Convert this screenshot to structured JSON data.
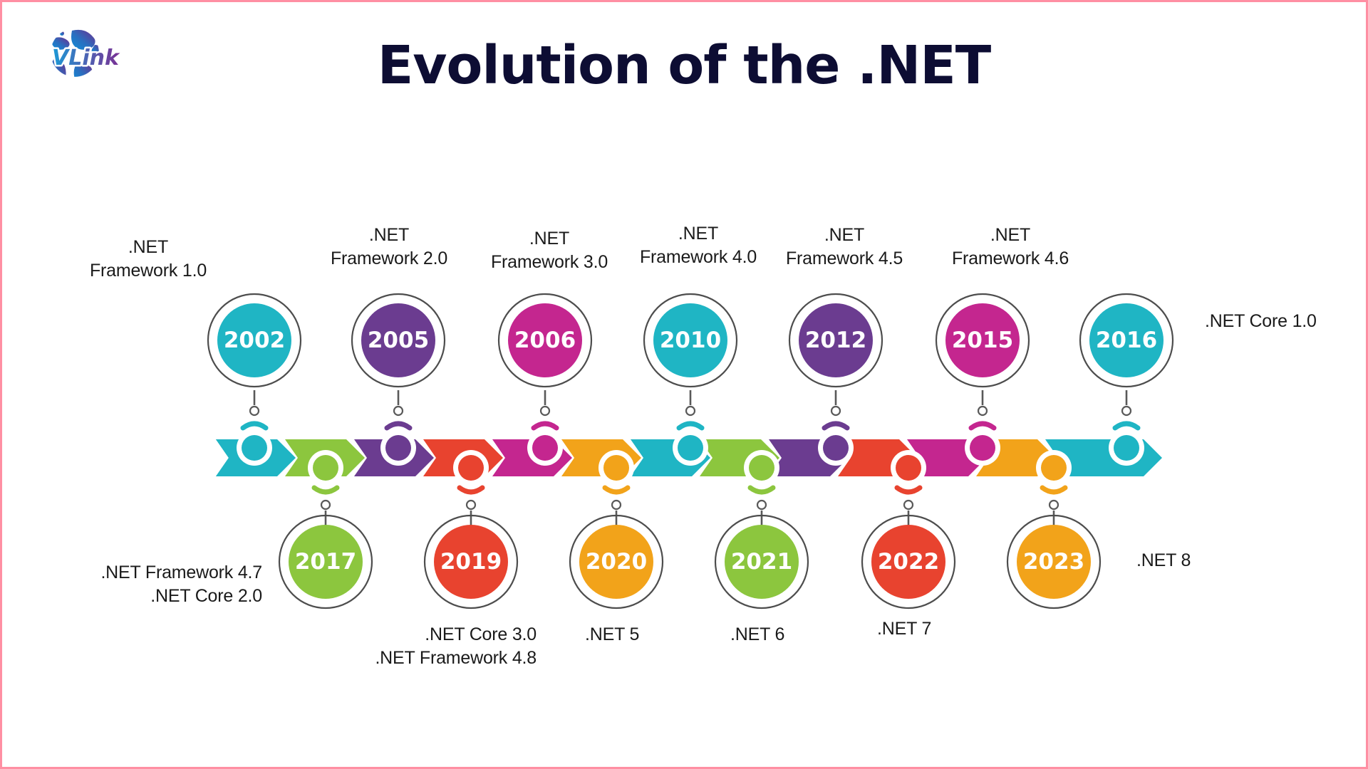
{
  "page": {
    "title": "Evolution of the .NET",
    "border_color": "#ff8fa3",
    "background": "#ffffff",
    "title_color": "#0d0d33"
  },
  "logo": {
    "name": "VLink",
    "text": "VLink",
    "gradient_start": "#1c9ad6",
    "gradient_end": "#6d2e8e"
  },
  "palette": {
    "teal": "#1fb5c4",
    "purple": "#6b3c90",
    "magenta": "#c4268f",
    "green": "#8cc63e",
    "red": "#e8432f",
    "orange": "#f2a31a",
    "ring": "#4d4d4d",
    "connector": "#595959",
    "white": "#ffffff"
  },
  "chart_data": {
    "type": "timeline",
    "title": "Evolution of the .NET",
    "orientation": "horizontal",
    "segment_count": 13,
    "segment_colors": [
      "teal",
      "green",
      "purple",
      "red",
      "magenta",
      "orange",
      "teal",
      "green",
      "purple",
      "red",
      "magenta",
      "orange",
      "teal"
    ],
    "events": [
      {
        "year": "2002",
        "label": ".NET\nFramework 1.0",
        "color": "teal",
        "side": "top",
        "label_pos": "center"
      },
      {
        "year": "2005",
        "label": ".NET\nFramework 2.0",
        "color": "purple",
        "side": "top",
        "label_pos": "center"
      },
      {
        "year": "2006",
        "label": ".NET\nFramework 3.0",
        "color": "magenta",
        "side": "top",
        "label_pos": "center"
      },
      {
        "year": "2010",
        "label": ".NET\nFramework 4.0",
        "color": "teal",
        "side": "top",
        "label_pos": "center"
      },
      {
        "year": "2012",
        "label": ".NET\nFramework 4.5",
        "color": "purple",
        "side": "top",
        "label_pos": "center"
      },
      {
        "year": "2015",
        "label": ".NET\nFramework 4.6",
        "color": "magenta",
        "side": "top",
        "label_pos": "center"
      },
      {
        "year": "2016",
        "label": ".NET Core 1.0",
        "color": "teal",
        "side": "top",
        "label_pos": "right"
      },
      {
        "year": "2017",
        "label": ".NET Framework 4.7\n.NET Core 2.0",
        "color": "green",
        "side": "bottom",
        "label_pos": "left"
      },
      {
        "year": "2019",
        "label": ".NET Core 3.0\n.NET Framework 4.8",
        "color": "red",
        "side": "bottom",
        "label_pos": "below"
      },
      {
        "year": "2020",
        "label": ".NET 5",
        "color": "orange",
        "side": "bottom",
        "label_pos": "below"
      },
      {
        "year": "2021",
        "label": ".NET 6",
        "color": "green",
        "side": "bottom",
        "label_pos": "below"
      },
      {
        "year": "2022",
        "label": ".NET 7",
        "color": "red",
        "side": "bottom",
        "label_pos": "below"
      },
      {
        "year": "2023",
        "label": ".NET 8",
        "color": "orange",
        "side": "bottom",
        "label_pos": "right"
      }
    ]
  },
  "labels": {
    "top": [
      {
        "line1": ".NET",
        "line2": "Framework 1.0"
      },
      {
        "line1": ".NET",
        "line2": "Framework 2.0"
      },
      {
        "line1": ".NET",
        "line2": "Framework 3.0"
      },
      {
        "line1": ".NET",
        "line2": "Framework 4.0"
      },
      {
        "line1": ".NET",
        "line2": "Framework 4.5"
      },
      {
        "line1": ".NET",
        "line2": "Framework 4.6"
      }
    ],
    "net_core_1_0": ".NET Core 1.0",
    "fw47_core20": ".NET Framework 4.7\n.NET Core 2.0",
    "core30_fw48": ".NET Core 3.0\n.NET Framework 4.8",
    "net5": ".NET 5",
    "net6": ".NET 6",
    "net7": ".NET 7",
    "net8": ".NET 8"
  },
  "years": {
    "y2002": "2002",
    "y2005": "2005",
    "y2006": "2006",
    "y2010": "2010",
    "y2012": "2012",
    "y2015": "2015",
    "y2016": "2016",
    "y2017": "2017",
    "y2019": "2019",
    "y2020": "2020",
    "y2021": "2021",
    "y2022": "2022",
    "y2023": "2023"
  }
}
